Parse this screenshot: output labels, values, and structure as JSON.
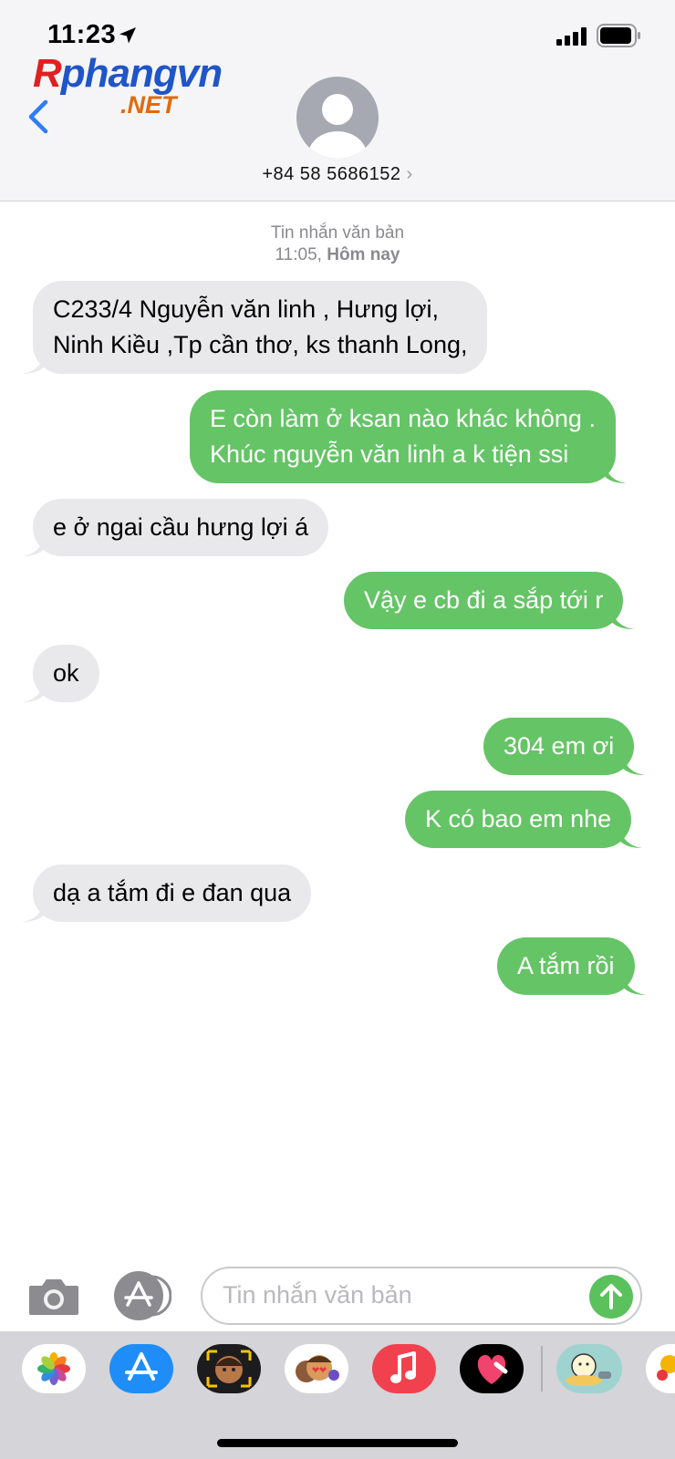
{
  "status_bar": {
    "time": "11:23"
  },
  "watermark": {
    "brand_main_red": "R",
    "brand_main_blue": "phangvn",
    "brand_sub": ".NET"
  },
  "contact": {
    "name": "+84 58 5686152",
    "chevron": "›"
  },
  "thread": {
    "timestamp_label": "Tin nhắn văn bản",
    "timestamp_time": "11:05,",
    "timestamp_day": "Hôm nay",
    "messages": [
      {
        "direction": "in",
        "lines": [
          "C233/4 Nguyễn văn linh , Hưng lợi,",
          "Ninh Kiều ,Tp cần thơ, ks thanh Long,"
        ]
      },
      {
        "direction": "out",
        "lines": [
          "E còn làm ở ksan nào khác không .",
          "Khúc nguyễn văn linh a k tiện ssi"
        ]
      },
      {
        "direction": "in",
        "lines": [
          "e ở ngai cầu hưng lợi á"
        ]
      },
      {
        "direction": "out",
        "lines": [
          "Vậy e cb đi a sắp tới r"
        ]
      },
      {
        "direction": "in",
        "lines": [
          "ok"
        ]
      },
      {
        "direction": "out",
        "lines": [
          "304 em ơi"
        ]
      },
      {
        "direction": "out",
        "lines": [
          "K có bao em nhe"
        ]
      },
      {
        "direction": "in",
        "lines": [
          "dạ a tắm đi e đan qua"
        ]
      },
      {
        "direction": "out",
        "lines": [
          "A tắm rồi"
        ]
      }
    ]
  },
  "composer": {
    "placeholder": "Tin nhắn văn bản"
  },
  "app_drawer": {
    "apps": [
      "photos-app-icon",
      "app-store-app-icon",
      "memoji-app-icon",
      "animoji-app-icon",
      "music-app-icon",
      "digital-touch-app-icon",
      "sticker-app-icon",
      "more-app-icon"
    ]
  },
  "colors": {
    "incoming_bubble": "#e9e9eb",
    "outgoing_bubble": "#65c466",
    "accent": "#2f7cf6",
    "header_bg": "#f5f5f7"
  }
}
